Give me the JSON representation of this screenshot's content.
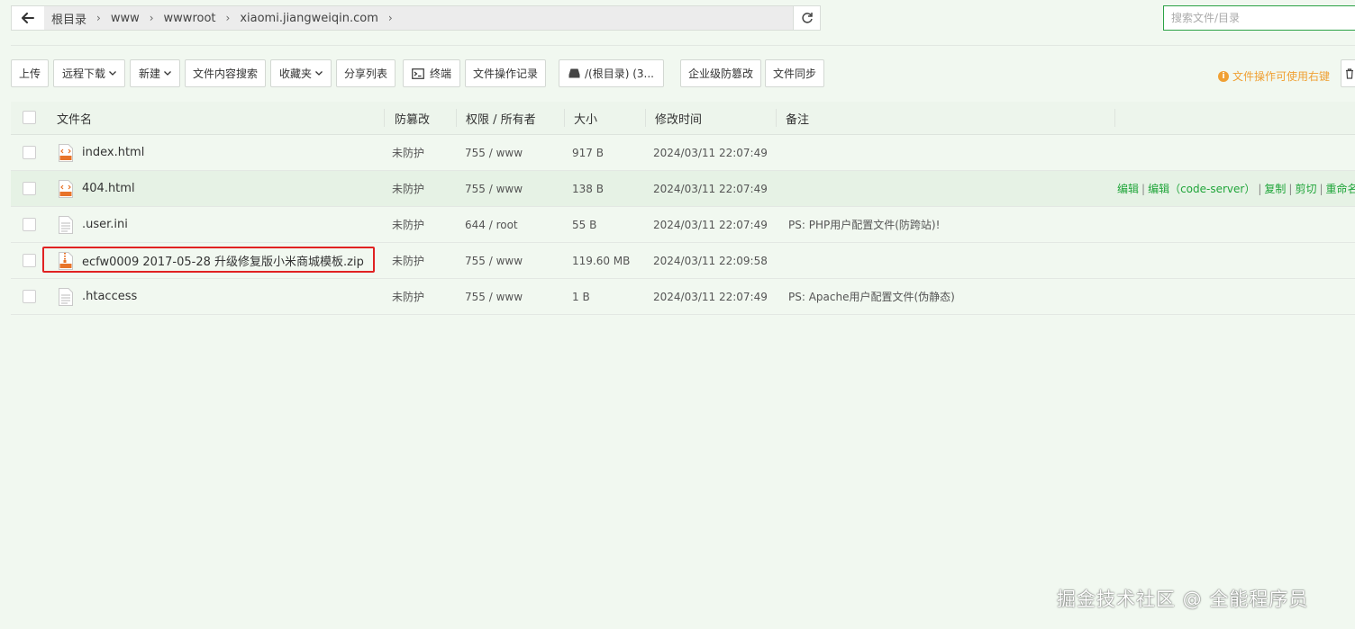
{
  "pathbar": {
    "crumbs": [
      "根目录",
      "www",
      "wwwroot",
      "xiaomi.jiangweiqin.com"
    ]
  },
  "search": {
    "placeholder": "搜索文件/目录"
  },
  "toolbar": {
    "upload": "上传",
    "remote_download": "远程下载",
    "new": "新建",
    "content_search": "文件内容搜索",
    "favorites": "收藏夹",
    "share_list": "分享列表",
    "terminal": "终端",
    "op_log": "文件操作记录",
    "disk": "/(根目录) (3...",
    "tamper_proof": "企业级防篡改",
    "file_sync": "文件同步",
    "tip": "文件操作可使用右键"
  },
  "table": {
    "headers": {
      "name": "文件名",
      "protect": "防篡改",
      "perm": "权限 / 所有者",
      "size": "大小",
      "mtime": "修改时间",
      "note": "备注"
    },
    "rows": [
      {
        "name": "index.html",
        "icon": "html-file-icon",
        "protect": "未防护",
        "perm": "755 / www",
        "size": "917 B",
        "mtime": "2024/03/11 22:07:49",
        "note": ""
      },
      {
        "name": "404.html",
        "icon": "html-file-icon",
        "protect": "未防护",
        "perm": "755 / www",
        "size": "138 B",
        "mtime": "2024/03/11 22:07:49",
        "note": ""
      },
      {
        "name": ".user.ini",
        "icon": "text-file-icon",
        "protect": "未防护",
        "perm": "644 / root",
        "size": "55 B",
        "mtime": "2024/03/11 22:07:49",
        "note": "PS: PHP用户配置文件(防跨站)!"
      },
      {
        "name": "ecfw0009 2017-05-28 升级修复版小米商城模板.zip",
        "icon": "zip-file-icon",
        "protect": "未防护",
        "perm": "755 / www",
        "size": "119.60 MB",
        "mtime": "2024/03/11 22:09:58",
        "note": ""
      },
      {
        "name": ".htaccess",
        "icon": "text-file-icon",
        "protect": "未防护",
        "perm": "755 / www",
        "size": "1 B",
        "mtime": "2024/03/11 22:07:49",
        "note": "PS: Apache用户配置文件(伪静态)"
      }
    ],
    "row_actions": {
      "edit": "编辑",
      "edit_code_server": "编辑（code-server）",
      "copy": "复制",
      "cut": "剪切",
      "rename": "重命名"
    }
  },
  "colors": {
    "accent": "#20a53a",
    "warning": "#f0a033",
    "highlight_box": "#e02222"
  },
  "watermark": "掘金技术社区 @ 全能程序员"
}
